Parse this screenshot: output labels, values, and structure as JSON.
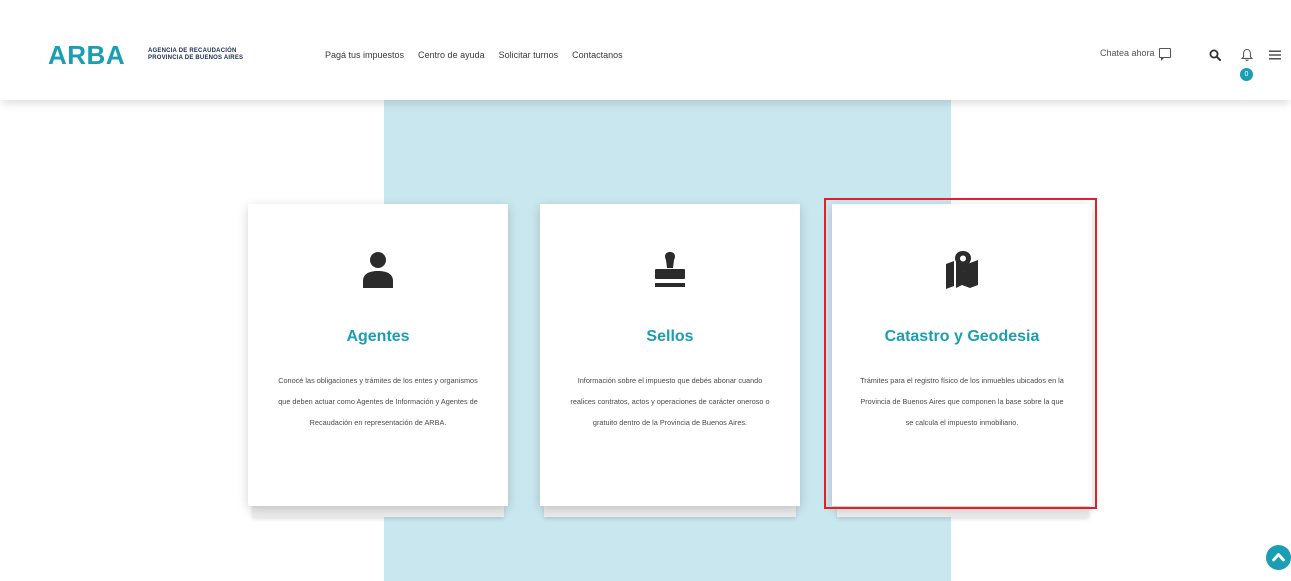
{
  "header": {
    "logo": "ARBA",
    "logo_sub_line1": "AGENCIA DE RECAUDACIÓN",
    "logo_sub_line2": "PROVINCIA DE BUENOS AIRES",
    "nav": [
      "Pagá tus impuestos",
      "Centro de ayuda",
      "Solicitar turnos",
      "Contactanos"
    ],
    "chat_label": "Chatea ahora",
    "notification_count": "0"
  },
  "cards": [
    {
      "title": "Agentes",
      "icon": "user-icon",
      "description": "Conocé las obligaciones y trámites de los entes y organismos que deben actuar como Agentes de Información y Agentes de Recaudación en representación de ARBA."
    },
    {
      "title": "Sellos",
      "icon": "stamp-icon",
      "description": "Información sobre el impuesto que debés abonar cuando realices contratos, actos y operaciones de carácter oneroso o gratuito dentro de la Provincia de Buenos Aires."
    },
    {
      "title": "Catastro y Geodesia",
      "icon": "map-location-icon",
      "description": "Trámites para el registro físico de los inmuebles ubicados en la Provincia de Buenos Aires que componen la base sobre la que se calcula el impuesto inmobiliario."
    }
  ],
  "colors": {
    "accent": "#1a9eb3",
    "panel": "#c9e7ee",
    "highlight": "#e3202a"
  }
}
